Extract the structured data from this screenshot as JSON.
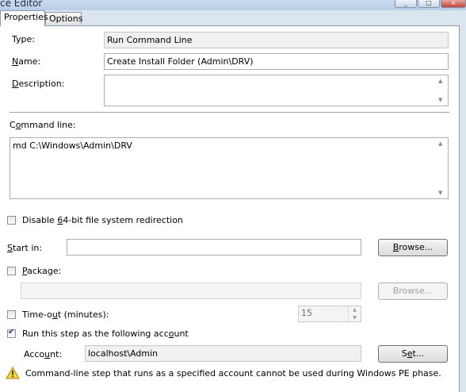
{
  "window": {
    "title": "ce Editor",
    "minimize": "_",
    "maximize": "□",
    "close": "×"
  },
  "tabs": [
    {
      "label": "Properties",
      "active": true
    },
    {
      "label": "Options",
      "active": false
    }
  ],
  "properties": {
    "type_label": "Type:",
    "type_value": "Run Command Line",
    "name_label_u": "N",
    "name_label_rest": "ame:",
    "name_value": "Create Install Folder (Admin\\DRV)",
    "description_label_u": "D",
    "description_label_rest": "escription:",
    "description_value": "",
    "command_line_label_pre": "C",
    "command_line_label_u": "o",
    "command_line_label_rest": "mmand line:",
    "command_line_value": "md C:\\Windows\\Admin\\DRV",
    "disable_redirection_pre": "Disable ",
    "disable_redirection_u": "6",
    "disable_redirection_rest": "4-bit file system redirection",
    "disable_redirection_checked": false,
    "start_in_label_u": "S",
    "start_in_label_rest": "tart in:",
    "start_in_value": "",
    "browse_u": "B",
    "browse_rest": "rowse...",
    "package_label_u": "P",
    "package_label_rest": "ackage:",
    "package_checked": false,
    "package_value": "",
    "browse2_label": "Browse...",
    "timeout_label_pre": "Time-o",
    "timeout_label_u": "u",
    "timeout_label_rest": "t (minutes):",
    "timeout_checked": false,
    "timeout_value": "15",
    "run_as_pre": "Run this step as the following acc",
    "run_as_u": "o",
    "run_as_rest": "unt",
    "run_as_checked": true,
    "account_label_pre": "Acco",
    "account_label_u": "u",
    "account_label_rest": "nt:",
    "account_value": "localhost\\Admin",
    "set_label_pre": "S",
    "set_label_u": "e",
    "set_label_rest": "t...",
    "warning_text": "Command-line step that runs as a specified account cannot be used during Windows PE phase."
  },
  "colors": {
    "warning": "#f5d33a",
    "check": "#2a3e8c",
    "accent": "#b8cde6"
  }
}
